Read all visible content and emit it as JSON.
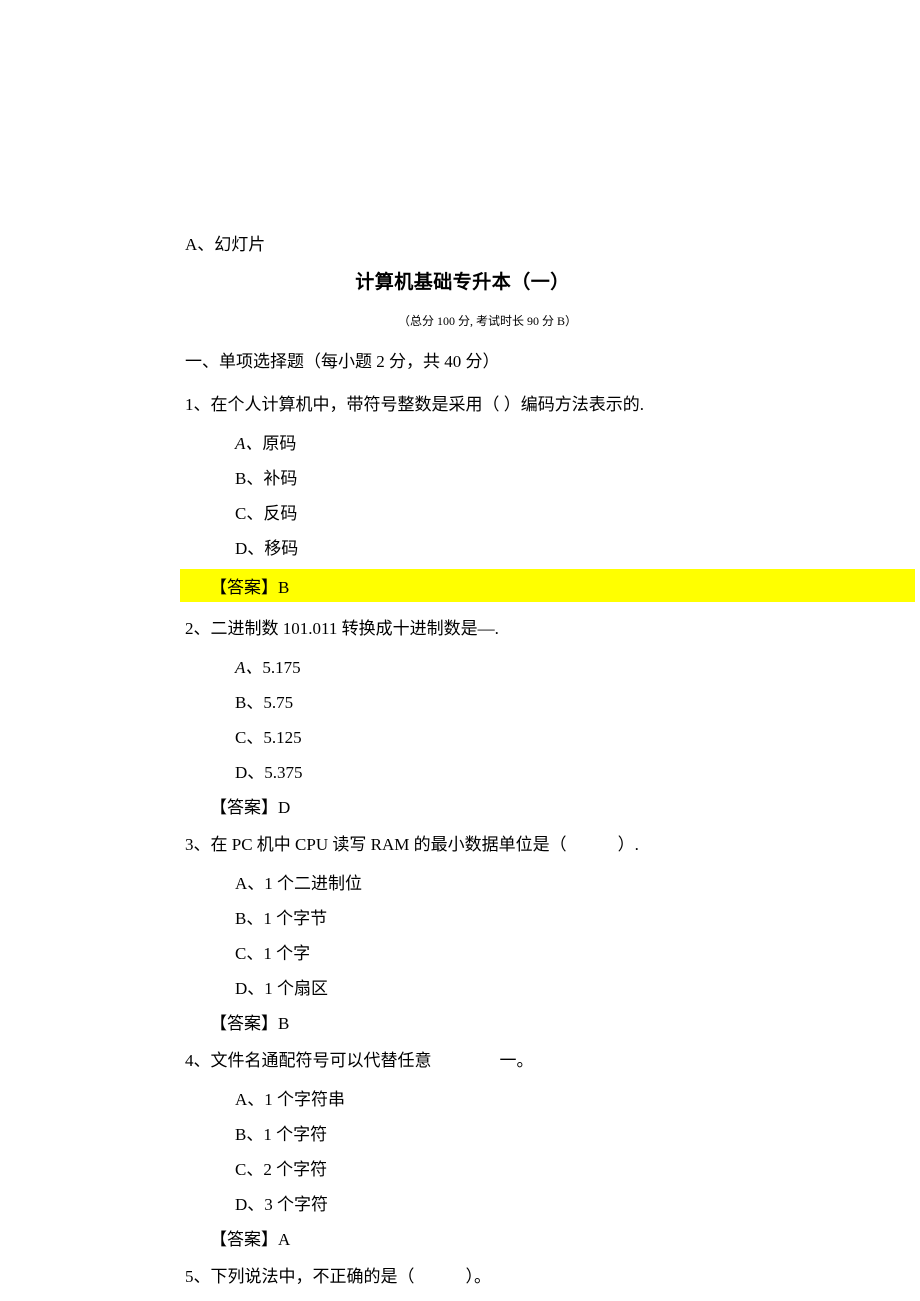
{
  "stray_option": "A、幻灯片",
  "title": "计算机基础专升本（一）",
  "subtitle": "（总分 100 分, 考试时长 90 分 B）",
  "section_heading": "一、单项选择题（每小题 2 分，共 40 分）",
  "questions": [
    {
      "text": "1、在个人计算机中，带符号整数是采用（ ）编码方法表示的.",
      "options": [
        {
          "label": "A、",
          "text": "原码",
          "italic": true
        },
        {
          "label": "B、",
          "text": "补码",
          "italic": false
        },
        {
          "label": "C、",
          "text": "反码",
          "italic": false
        },
        {
          "label": "D、",
          "text": "移码",
          "italic": false
        }
      ],
      "answer_label": "【答案】",
      "answer_value": "B",
      "highlight": true
    },
    {
      "text": "2、二进制数 101.011 转换成十进制数是—.",
      "options": [
        {
          "label": "A、",
          "text": "5.175",
          "italic": true
        },
        {
          "label": "B、",
          "text": "5.75",
          "italic": false
        },
        {
          "label": "C、",
          "text": "5.125",
          "italic": false
        },
        {
          "label": "D、",
          "text": "5.375",
          "italic": false
        }
      ],
      "answer_label": "【答案】",
      "answer_value": "D",
      "highlight": false
    },
    {
      "text": "3、在 PC 机中 CPU 读写 RAM 的最小数据单位是（　　　）.",
      "options": [
        {
          "label": "A、",
          "text": "1 个二进制位",
          "italic": false
        },
        {
          "label": "B、",
          "text": "1 个字节",
          "italic": false
        },
        {
          "label": "C、",
          "text": "1 个字",
          "italic": false
        },
        {
          "label": "D、",
          "text": "1 个扇区",
          "italic": false
        }
      ],
      "answer_label": "【答案】",
      "answer_value": "B",
      "highlight": false
    },
    {
      "text": "4、文件名通配符号可以代替任意　　　　一。",
      "options": [
        {
          "label": "A、",
          "text": "1 个字符串",
          "italic": false
        },
        {
          "label": "B、",
          "text": "1 个字符",
          "italic": false
        },
        {
          "label": "C、",
          "text": "2 个字符",
          "italic": false
        },
        {
          "label": "D、",
          "text": "3 个字符",
          "italic": false
        }
      ],
      "answer_label": "【答案】",
      "answer_value": "A",
      "highlight": false
    },
    {
      "text": "5、下列说法中，不正确的是（　　　）。",
      "options": [],
      "answer_label": "",
      "answer_value": "",
      "highlight": false
    }
  ]
}
